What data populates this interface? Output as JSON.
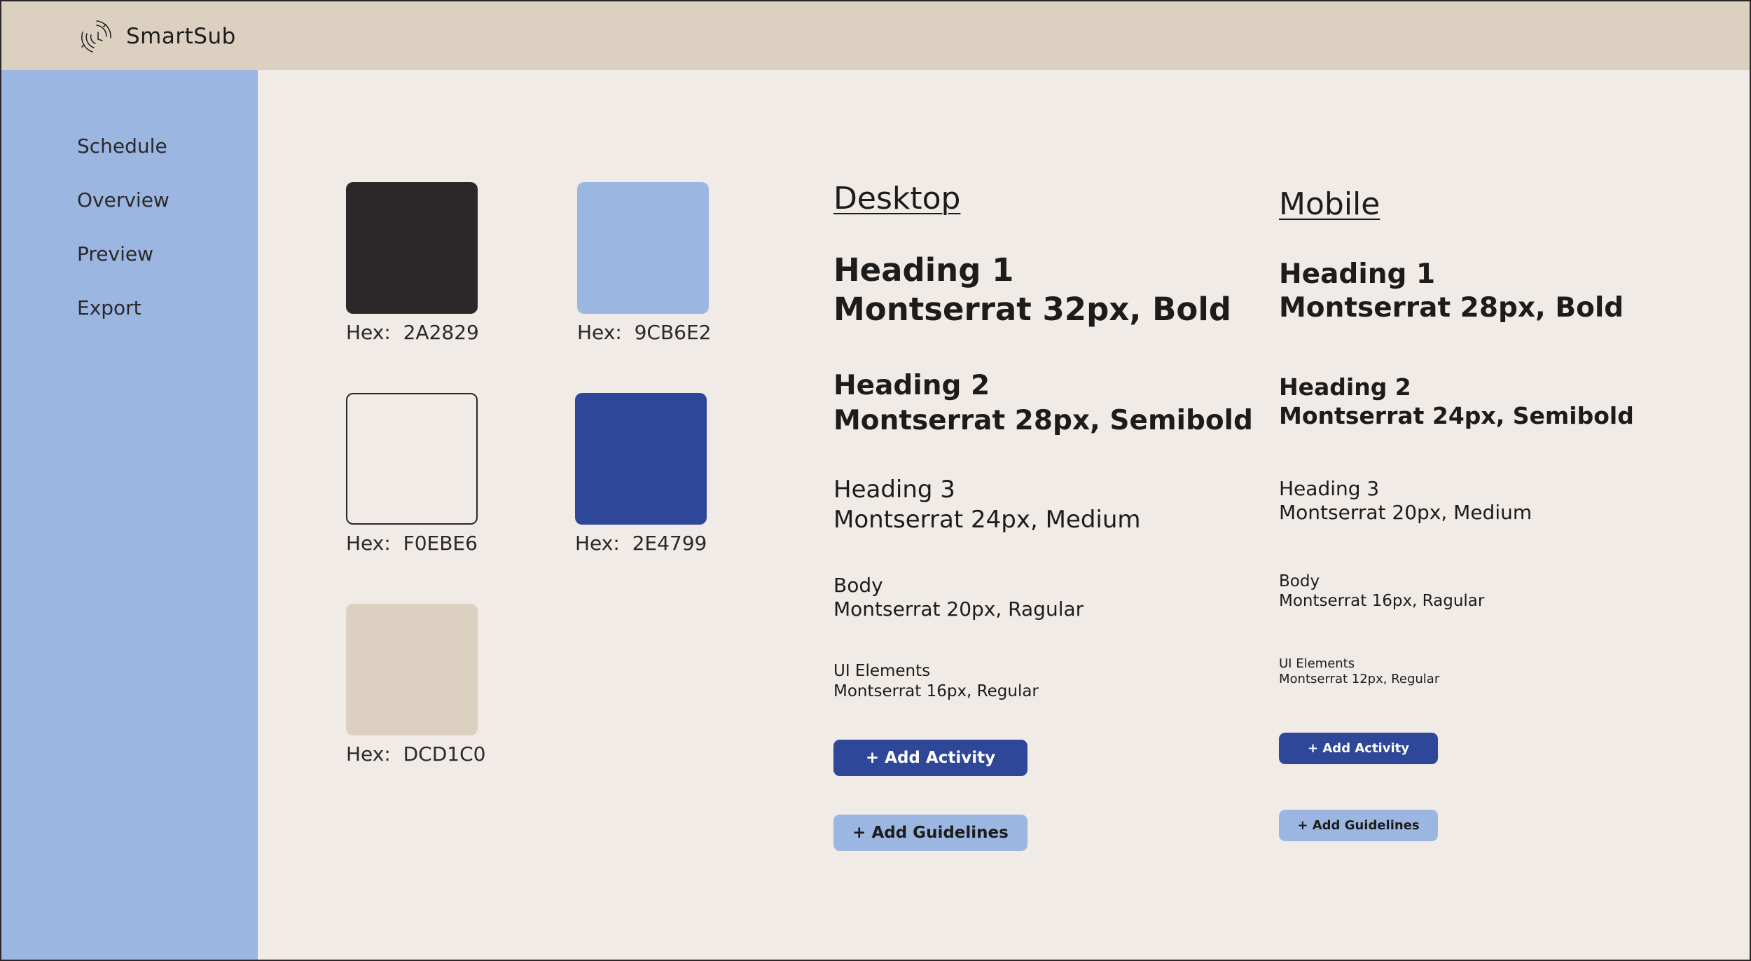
{
  "app": {
    "name": "SmartSub"
  },
  "sidebar": {
    "items": [
      {
        "label": "Schedule"
      },
      {
        "label": "Overview"
      },
      {
        "label": "Preview"
      },
      {
        "label": "Export"
      }
    ]
  },
  "palette": {
    "swatches": [
      {
        "label": "Hex:  2A2829",
        "color": "#2A2829"
      },
      {
        "label": "Hex:  9CB6E2",
        "color": "#9CB6E2"
      },
      {
        "label": "Hex:  F0EBE6",
        "color": "#F0EBE6"
      },
      {
        "label": "Hex:  2E4799",
        "color": "#2E4799"
      },
      {
        "label": "Hex:  DCD1C0",
        "color": "#DCD1C0"
      }
    ]
  },
  "desktop": {
    "title": "Desktop",
    "h1": {
      "name": "Heading 1",
      "spec": "Montserrat 32px, Bold"
    },
    "h2": {
      "name": "Heading 2",
      "spec": "Montserrat 28px, Semibold"
    },
    "h3": {
      "name": "Heading 3",
      "spec": "Montserrat 24px, Medium"
    },
    "body": {
      "name": "Body",
      "spec": "Montserrat 20px, Ragular"
    },
    "ui": {
      "name": "UI Elements",
      "spec": "Montserrat 16px, Regular"
    },
    "add_activity": "+ Add Activity",
    "add_guidelines": "+ Add Guidelines"
  },
  "mobile": {
    "title": "Mobile",
    "h1": {
      "name": "Heading 1",
      "spec": "Montserrat 28px, Bold"
    },
    "h2": {
      "name": "Heading 2",
      "spec": "Montserrat 24px, Semibold"
    },
    "h3": {
      "name": "Heading 3",
      "spec": "Montserrat 20px, Medium"
    },
    "body": {
      "name": "Body",
      "spec": "Montserrat 16px, Ragular"
    },
    "ui": {
      "name": "UI Elements",
      "spec": "Montserrat 12px, Regular"
    },
    "add_activity": "+ Add Activity",
    "add_guidelines": "+ Add Guidelines"
  }
}
